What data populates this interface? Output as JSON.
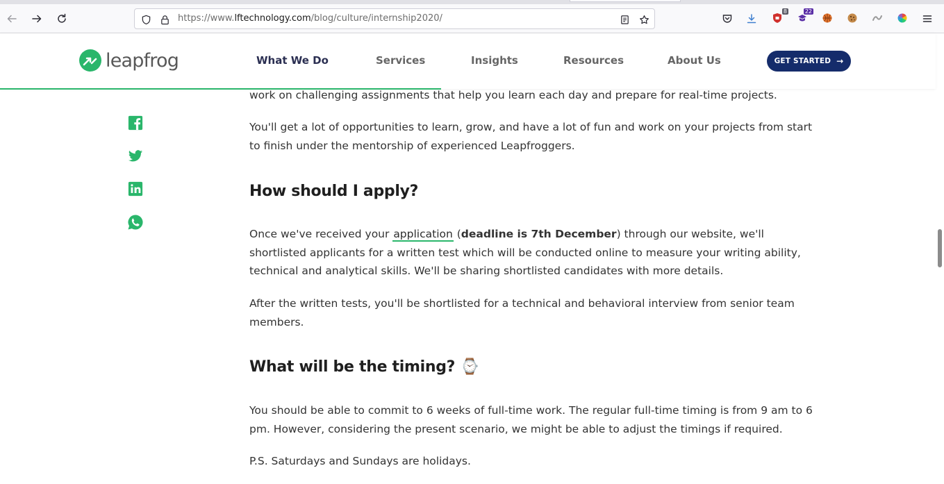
{
  "browser": {
    "url_prefix": "https://www.",
    "url_host": "lftechnology.com",
    "url_path": "/blog/culture/internship2020/",
    "icons": [
      "back-icon",
      "forward-icon",
      "reload-icon",
      "shield-icon",
      "lock-icon",
      "reader-view-icon",
      "bookmark-star-icon",
      "pocket-icon",
      "downloads-icon"
    ],
    "extensions": [
      {
        "name": "ublock-extension-icon",
        "badge": "8",
        "color": "#d0312d"
      },
      {
        "name": "purple-extension-icon",
        "badge": "22",
        "color": "#5a2ea6"
      },
      {
        "name": "basketball-extension-icon",
        "color": "#e8772e"
      },
      {
        "name": "cookie-extension-icon",
        "color": "#8b5a2b"
      },
      {
        "name": "gray-extension-icon",
        "color": "#9a9a9a"
      },
      {
        "name": "color-wheel-extension-icon",
        "color": "#e74c3c"
      }
    ]
  },
  "header": {
    "logo_text": "leapfrog",
    "nav": [
      "What We Do",
      "Services",
      "Insights",
      "Resources",
      "About Us"
    ],
    "cta_label": "GET STARTED",
    "brand_color": "#2ab66b",
    "cta_color": "#152c6b"
  },
  "share": [
    "facebook-icon",
    "twitter-icon",
    "linkedin-icon",
    "whatsapp-icon"
  ],
  "article": {
    "p0": "work on challenging assignments that help you learn each day and prepare for real-time projects.",
    "p1": "You'll get a lot of opportunities to learn, grow, and have a lot of fun and work on your projects from start to finish under the mentorship of experienced Leapfroggers.",
    "h_apply": "How should I apply?",
    "p2_before": "Once we've received your ",
    "p2_link": "application",
    "p2_open": " (",
    "p2_bold": "deadline is 7th December",
    "p2_after": ") through our website, we'll shortlisted applicants for a written test which will be conducted online to measure your writing ability, technical and analytical skills. We'll be sharing shortlisted candidates with more details.",
    "p3": "After the written tests, you'll be shortlisted for a technical and behavioral interview from senior team members.",
    "h_timing": "What will be the timing?",
    "h_timing_emoji": "⌚",
    "p4": "You should be able to commit to 6 weeks of full-time work. The regular full-time timing is from 9 am to 6 pm. However, considering the present scenario, we might be able to adjust the timings if required.",
    "p5": "P.S. Saturdays and Sundays are holidays."
  }
}
